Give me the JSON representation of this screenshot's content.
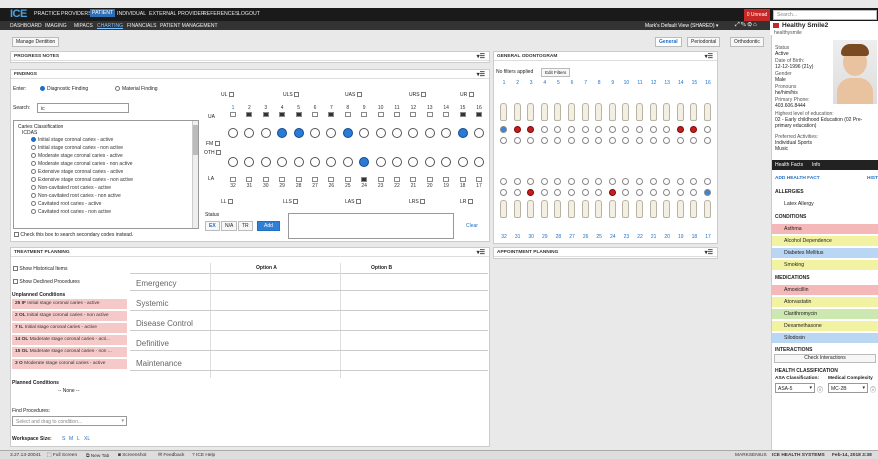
{
  "topnav": {
    "logo": "ICE",
    "items": [
      "PRACTICE",
      "PROVIDERS",
      "PATIENT",
      "INDIVIDUAL",
      "EXTERNAL PROVIDER",
      "REFERENCES",
      "LOGOUT"
    ],
    "active": "PATIENT",
    "unread": "0 Unread",
    "search_placeholder": "Search..."
  },
  "subnav": {
    "items": [
      "DASHBOARD",
      "IMAGING",
      "MIPACS",
      "CHARTING",
      "FINANCIALS",
      "PATIENT MANAGEMENT"
    ],
    "active": "CHARTING",
    "view": "Mark's Default View (SHARED) ▾"
  },
  "toolbar": {
    "manage_dentition": "Manage Dentition",
    "tabs": [
      "General",
      "Periodontal",
      "Orthodontic"
    ],
    "active_tab": "General"
  },
  "progress_notes": {
    "title": "PROGRESS NOTES"
  },
  "findings": {
    "title": "FINDINGS",
    "enter_label": "Enter:",
    "diagnostic": "Diagnostic Finding",
    "material": "Material Finding",
    "search_label": "Search:",
    "search_value": "ic",
    "classification": "Caries Classification",
    "icdas": "ICDAS",
    "items": [
      "Initial stage coronal caries - active",
      "Initial stage coronal caries - non active",
      "Moderate stage coronal caries - active",
      "Moderate stage coronal caries - non active",
      "Extensive stage coronal caries - active",
      "Extensive stage coronal caries - non active",
      "Non-cavitated root caries - active",
      "Non-cavitated root caries - non active",
      "Cavitated root caries - active",
      "Cavitated root caries - non active"
    ],
    "secondary": "Check this box to search secondary codes instead.",
    "quadrants_top": [
      "UL",
      "ULS",
      "UAS",
      "URS",
      "UR"
    ],
    "quadrants_bottom": [
      "LL",
      "LLS",
      "LAS",
      "LRS",
      "LR"
    ],
    "upper_nums": [
      "1",
      "2",
      "3",
      "4",
      "5",
      "6",
      "7",
      "8",
      "9",
      "10",
      "11",
      "12",
      "13",
      "14",
      "15",
      "16"
    ],
    "lower_nums": [
      "32",
      "31",
      "30",
      "29",
      "28",
      "27",
      "26",
      "25",
      "24",
      "23",
      "22",
      "21",
      "20",
      "19",
      "18",
      "17"
    ],
    "ua": "UA",
    "la": "LA",
    "fm": "FM",
    "oth": "OTH",
    "status_label": "Status",
    "status_buttons": [
      "EX",
      "N/A",
      "TR"
    ],
    "add": "Add",
    "clear": "Clear"
  },
  "odontogram": {
    "title": "GENERAL ODONTOGRAM",
    "no_filters": "No filters applied",
    "edit_filters": "Edit Filters",
    "upper_nums": [
      "1",
      "2",
      "3",
      "4",
      "5",
      "6",
      "7",
      "8",
      "9",
      "10",
      "11",
      "12",
      "13",
      "14",
      "15",
      "16"
    ],
    "lower_nums": [
      "32",
      "31",
      "30",
      "29",
      "28",
      "27",
      "26",
      "25",
      "24",
      "23",
      "22",
      "21",
      "20",
      "19",
      "18",
      "17"
    ]
  },
  "appointment": {
    "title": "APPOINTMENT PLANNING"
  },
  "treatment": {
    "title": "TREATMENT PLANNING",
    "show_historical": "Show Historical Items",
    "show_declined": "Show Declined Procedures",
    "option_a": "Option A",
    "option_b": "Option B",
    "unplanned_title": "Unplanned Conditions",
    "unplanned": [
      {
        "code": "25 IF",
        "desc": "Initial stage coronal caries - active"
      },
      {
        "code": "2 OL",
        "desc": "Initial stage coronal caries - non active"
      },
      {
        "code": "7 IL",
        "desc": "Initial stage coronal caries - active"
      },
      {
        "code": "14 OL",
        "desc": "Moderate stage coronal caries - acti..."
      },
      {
        "code": "15 OL",
        "desc": "Moderate stage coronal caries - non ..."
      },
      {
        "code": "3 O",
        "desc": "Moderate stage coronal caries - active"
      }
    ],
    "categories": [
      "Emergency",
      "Systemic",
      "Disease Control",
      "Definitive",
      "Maintenance"
    ],
    "planned_title": "Planned Conditions",
    "planned_none": "-- None --",
    "find_label": "Find Procedures:",
    "find_placeholder": "Select and drag to condition...",
    "workspace_label": "Workspace Size:",
    "sizes": [
      "S",
      "M",
      "L",
      "XL"
    ]
  },
  "patient": {
    "name": "Healthy Smile2",
    "username": "healthysmile",
    "status_label": "Status",
    "status": "Active",
    "dob_label": "Date of Birth:",
    "dob": "12-12-1996 (21y)",
    "gender_label": "Gender",
    "gender": "Male",
    "pronouns_label": "Pronouns",
    "pronouns": "he/him/his",
    "phone_label": "Primary Phone:",
    "phone": "403.606.8444",
    "education_label": "Highest level of education:",
    "education": "02 - Early childhood Education (02 Pre-primary education)",
    "activities_label": "Preferred Activities:",
    "activities": "Individual Sports",
    "music": "Music",
    "tabs": [
      "Health Facts",
      "Info"
    ],
    "add_health_fact": "ADD HEALTH FACT",
    "hist": "HIST",
    "allergies_title": "ALLERGIES",
    "allergies": [
      "Latex Allergy"
    ],
    "conditions_title": "CONDITIONS",
    "conditions": [
      "Asthma",
      "Alcohol Dependence",
      "Diabetes Mellitus",
      "Smoking"
    ],
    "medications_title": "MEDICATIONS",
    "medications": [
      "Amoxicillin",
      "Atorvastatin",
      "Clarithromycin",
      "Dexamethasone",
      "Silodosin"
    ],
    "interactions_title": "INTERACTIONS",
    "check_interactions": "Check Interactions",
    "health_class_title": "HEALTH CLASSIFICATION",
    "asa_label": "ASA Classification:",
    "asa_value": "ASA-5",
    "mc_label": "Medical Complexity",
    "mc_value": "MC-2B"
  },
  "statusbar": {
    "version": "3.27.13-20041",
    "items": [
      "Full Screen",
      "New Tab",
      "Screenshot",
      "Feedback",
      "ICE Help"
    ],
    "user": "MARKSENIUS",
    "org": "ICE HEALTH SYSTEMS",
    "date": "Feb-14, 2018 3:38"
  },
  "colors": {
    "accent": "#1e6fc6",
    "filled_tooth": "#2a7bd6",
    "condition_red": "#f4b8b8",
    "topbar": "#1a1a1a"
  }
}
